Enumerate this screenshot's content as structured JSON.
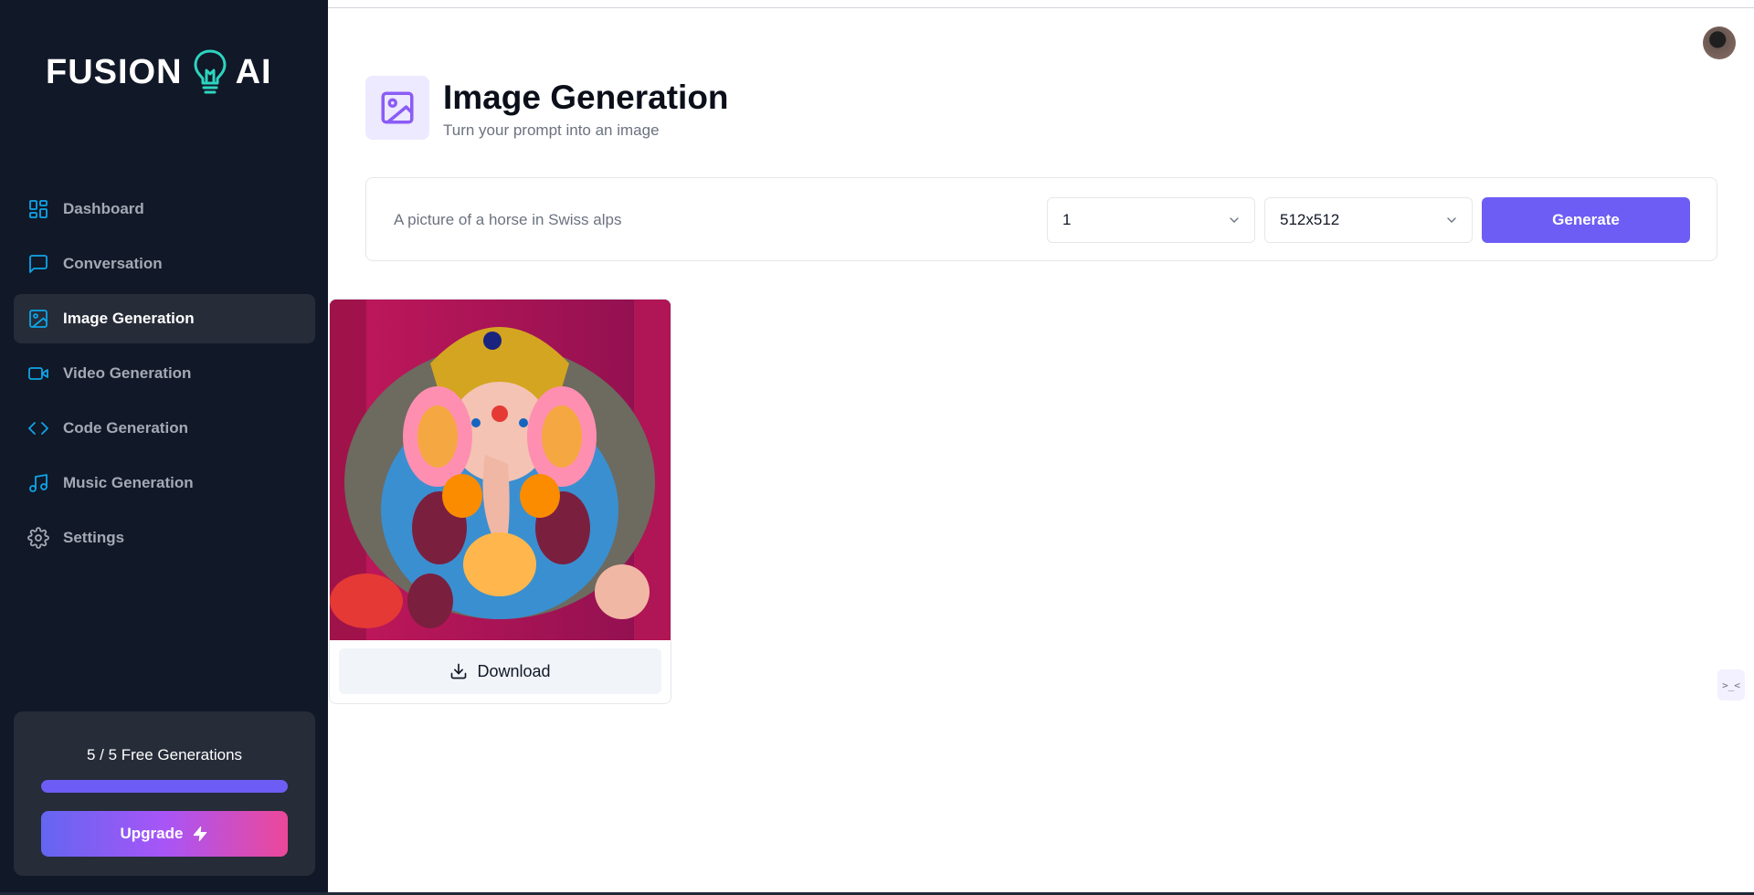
{
  "app": {
    "logo_left": "FUSION",
    "logo_right": "AI"
  },
  "sidebar": {
    "items": [
      {
        "label": "Dashboard",
        "icon": "dashboard-icon"
      },
      {
        "label": "Conversation",
        "icon": "message-square-icon"
      },
      {
        "label": "Image Generation",
        "icon": "image-icon",
        "active": true
      },
      {
        "label": "Video Generation",
        "icon": "video-icon"
      },
      {
        "label": "Code Generation",
        "icon": "code-icon"
      },
      {
        "label": "Music Generation",
        "icon": "music-icon"
      },
      {
        "label": "Settings",
        "icon": "settings-icon"
      }
    ],
    "free_generations": {
      "text": "5 / 5 Free Generations",
      "used": 5,
      "total": 5
    },
    "upgrade_label": "Upgrade"
  },
  "page": {
    "title": "Image Generation",
    "subtitle": "Turn your prompt into an image"
  },
  "form": {
    "prompt_placeholder": "A picture of a horse in Swiss alps",
    "amount_value": "1",
    "resolution_value": "512x512",
    "generate_label": "Generate"
  },
  "result": {
    "image_alt": "Generated image",
    "download_label": "Download"
  },
  "widget": {
    "text": ">_<"
  },
  "colors": {
    "sidebar_bg": "#111827",
    "accent": "#6d5df4",
    "icon_blue": "#0ea5e9",
    "header_icon_bg": "#ede9fe",
    "header_icon_color": "#8b5cf6"
  }
}
